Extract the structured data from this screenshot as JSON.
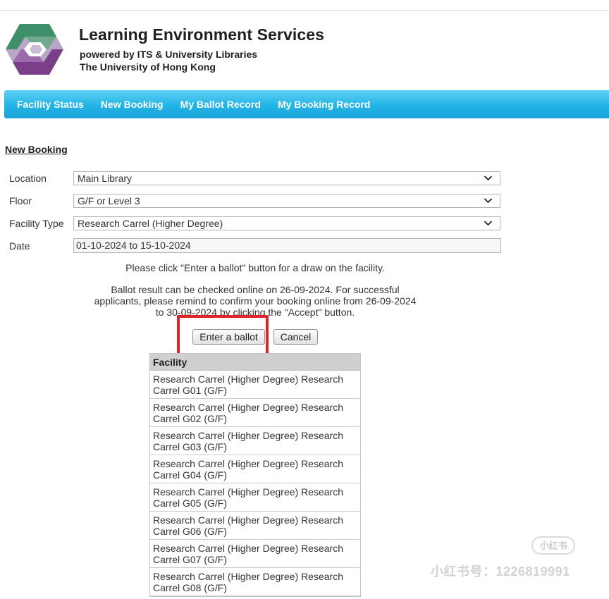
{
  "header": {
    "title": "Learning Environment Services",
    "subtitle_line1": "powered by ITS & University Libraries",
    "subtitle_line2": "The University of Hong Kong"
  },
  "nav": {
    "items": [
      "Facility Status",
      "New Booking",
      "My Ballot Record",
      "My Booking Record"
    ]
  },
  "section_title": "New Booking",
  "form": {
    "location": {
      "label": "Location",
      "value": "Main Library"
    },
    "floor": {
      "label": "Floor",
      "value": "G/F or Level 3"
    },
    "facility_type": {
      "label": "Facility Type",
      "value": "Research Carrel (Higher Degree)"
    },
    "date": {
      "label": "Date",
      "value": "01-10-2024 to 15-10-2024"
    }
  },
  "notes": {
    "instruction": "Please click \"Enter a ballot\" button for a draw on the facility.",
    "result_line1": "Ballot result can be checked online on 26-09-2024. For successful",
    "result_line2": "applicants, please remind to confirm your booking online from 26-09-2024",
    "result_line3": "to 30-09-2024 by clicking the \"Accept\" button."
  },
  "buttons": {
    "ballot": "Enter a ballot",
    "cancel": "Cancel"
  },
  "table": {
    "header": "Facility",
    "rows": [
      {
        "line1": "Research Carrel (Higher Degree) Research",
        "line2": "Carrel G01 (G/F)"
      },
      {
        "line1": "Research Carrel (Higher Degree) Research",
        "line2": "Carrel G02 (G/F)"
      },
      {
        "line1": "Research Carrel (Higher Degree) Research",
        "line2": "Carrel G03 (G/F)"
      },
      {
        "line1": "Research Carrel (Higher Degree) Research",
        "line2": "Carrel G04 (G/F)"
      },
      {
        "line1": "Research Carrel (Higher Degree) Research",
        "line2": "Carrel G05 (G/F)"
      },
      {
        "line1": "Research Carrel (Higher Degree) Research",
        "line2": "Carrel G06 (G/F)"
      },
      {
        "line1": "Research Carrel (Higher Degree) Research",
        "line2": "Carrel G07 (G/F)"
      },
      {
        "line1": "Research Carrel (Higher Degree) Research",
        "line2": "Carrel G08 (G/F)"
      }
    ]
  },
  "watermark": {
    "badge": "小红书",
    "text": "小红书号：1226819991"
  },
  "colors": {
    "nav": "#22b4e7",
    "highlight": "#e0232b",
    "table_header": "#cfcfcf",
    "logo_green": "#3f8f6b",
    "logo_purple": "#7b3f8a"
  },
  "icons": [
    "les-logo",
    "chevron-down-icon"
  ]
}
